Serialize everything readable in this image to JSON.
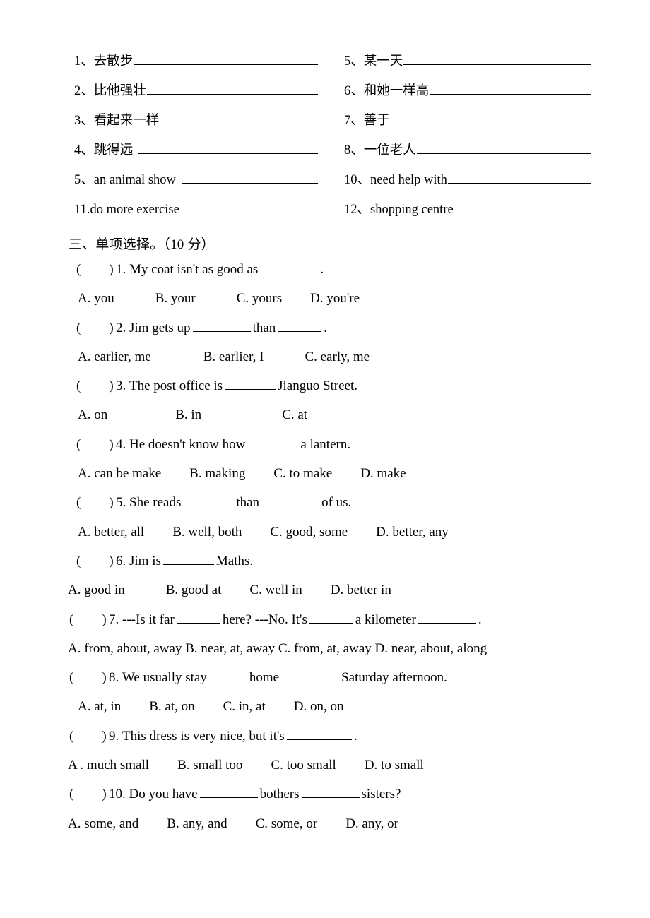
{
  "phrases": {
    "rows": [
      {
        "left": {
          "num": "1、",
          "text": "去散步",
          "gap": false
        },
        "right": {
          "num": "5、",
          "text": "某一天",
          "gap": false
        }
      },
      {
        "left": {
          "num": "2、",
          "text": "比他强壮",
          "gap": false
        },
        "right": {
          "num": "6、",
          "text": "和她一样高",
          "gap": false
        }
      },
      {
        "left": {
          "num": "3、",
          "text": "看起来一样",
          "gap": false
        },
        "right": {
          "num": "7、",
          "text": "善于",
          "gap": false
        }
      },
      {
        "left": {
          "num": "4、",
          "text": "跳得远",
          "gap": true
        },
        "right": {
          "num": "8、",
          "text": "一位老人",
          "gap": false
        }
      },
      {
        "left": {
          "num": "5、",
          "text": "an animal show",
          "gap": true
        },
        "right": {
          "num": "10、",
          "text": "need help with",
          "gap": false
        }
      },
      {
        "left": {
          "num": "11.",
          "text": "do more exercise",
          "gap": false
        },
        "right": {
          "num": "12、",
          "text": "shopping centre",
          "gap": true
        }
      }
    ]
  },
  "section": {
    "heading": "三、单项选择。（10 分）"
  },
  "questions": [
    {
      "paren_open": "(",
      "paren_close": ")",
      "number": "1.",
      "stem_before": "My coat isn't as good as",
      "stem_after": ".",
      "options": [
        "A. you",
        "B. your",
        "C. yours",
        "D. you're"
      ]
    },
    {
      "paren_open": "(",
      "paren_close": ")",
      "number": "2.",
      "stem_before": "Jim gets up",
      "stem_mid": "than",
      "stem_after": ".",
      "options": [
        "A. earlier, me",
        "B. earlier, I",
        "C. early, me"
      ]
    },
    {
      "paren_open": "(",
      "paren_close": ")",
      "number": "3.",
      "stem_before": "The post office is",
      "stem_after": "Jianguo Street.",
      "options": [
        "A. on",
        "B. in",
        "C. at"
      ]
    },
    {
      "paren_open": "(",
      "paren_close": ")",
      "number": "4.",
      "stem_before": "He doesn't know how",
      "stem_after": "a lantern.",
      "options": [
        "A. can be make",
        "B. making",
        "C. to make",
        "D. make"
      ]
    },
    {
      "paren_open": "(",
      "paren_close": ")",
      "number": "5.",
      "stem_before": "She reads",
      "stem_mid": "than",
      "stem_after": "of us.",
      "options": [
        "A. better, all",
        "B. well, both",
        "C. good, some",
        "D. better, any"
      ]
    },
    {
      "paren_open": "(",
      "paren_close": ")",
      "number": "6.",
      "stem_before": "Jim is",
      "stem_after": "Maths.",
      "options": [
        "A. good in",
        "B. good at",
        "C. well in",
        "D. better in"
      ]
    },
    {
      "paren_open": "(",
      "paren_close": ")",
      "number": "7.",
      "stem_before": "---Is it far",
      "stem_mid": "here? ---No. It's",
      "stem_mid2": "a kilometer",
      "stem_after": ".",
      "options_single": "A. from, about, away B. near, at, away C. from, at, away D. near, about, along"
    },
    {
      "paren_open": "(",
      "paren_close": ")",
      "number": "8.",
      "stem_before": "We usually stay",
      "stem_mid": "home",
      "stem_after": "Saturday afternoon.",
      "options": [
        "A. at, in",
        "B. at, on",
        "C. in, at",
        "D. on, on"
      ]
    },
    {
      "paren_open": "(",
      "paren_close": ")",
      "number": "9.",
      "stem_before": "This dress is very nice, but it's",
      "stem_after": ".",
      "options": [
        "A . much small",
        "B. small too",
        "C. too small",
        "D. to small"
      ]
    },
    {
      "paren_open": "(",
      "paren_close": ")",
      "number": "10.",
      "stem_before": "Do you have",
      "stem_mid": "bothers",
      "stem_after": "sisters?",
      "options": [
        "A. some, and",
        "B. any, and",
        "C. some, or",
        "D. any, or"
      ]
    }
  ]
}
